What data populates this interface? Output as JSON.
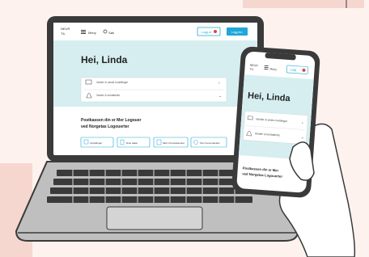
{
  "colors": {
    "background": "#fdf2ee",
    "accent_block": "#f6d7cf",
    "screen_bg": "#d6eef0",
    "brand_blue": "#1fa7d8",
    "alert_red": "#e0463f",
    "outline": "#3a3a3a"
  },
  "laptop": {
    "logo_lines": [
      "NEUR",
      "TIL"
    ],
    "nav_items": [
      "Meny",
      "Søk"
    ],
    "header_buttons": [
      "Logg ut",
      "Logg inn"
    ],
    "greeting": "Hei, Linda",
    "list_items": [
      "Varsler & varsel-innstillinger",
      "Varsler & kontaktinfo"
    ],
    "section_title_line1": "Postkassen din er Mer Logouer",
    "section_title_line2": "ved Norgetas Logouerter",
    "quick_actions": [
      "Innstillinger",
      "Dine saker",
      "Skriv til kundesenter",
      "Finn henvendelser"
    ]
  },
  "phone": {
    "logo_lines": [
      "NEUR",
      "TIL"
    ],
    "menu_label": "Meny",
    "login_label": "Logg",
    "greeting": "Hei, Linda",
    "list_items": [
      "Varsler & andre meldinger",
      "Varsler & kontaktinfo"
    ],
    "section_title_line1": "Postkassen din er Mer",
    "section_title_line2": "ved Norgetas Logouerter"
  }
}
